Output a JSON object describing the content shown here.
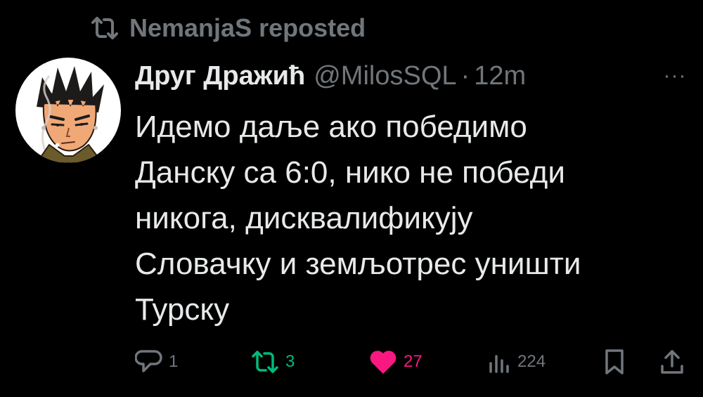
{
  "repost": {
    "icon": "repost-icon",
    "text": "NemanjaS reposted"
  },
  "tweet": {
    "author": {
      "display_name": "Друг Дражић",
      "handle": "@MilosSQL",
      "separator": "·",
      "time": "12m",
      "avatar_icon": "anime-character-avatar"
    },
    "more_icon": "more-icon",
    "more_label": "···",
    "body_lines": [
      "Идемо даље ако победимо",
      "Данску са 6:0, нико не победи",
      "никога, дисквалификују",
      "Словачку и земљотрес уништи",
      "Турску"
    ],
    "actions": {
      "reply": {
        "icon": "reply-icon",
        "count": "1"
      },
      "repost": {
        "icon": "repost-icon",
        "count": "3"
      },
      "like": {
        "icon": "heart-icon",
        "count": "27"
      },
      "views": {
        "icon": "views-icon",
        "count": "224"
      },
      "bookmark": {
        "icon": "bookmark-icon"
      },
      "share": {
        "icon": "share-icon"
      }
    }
  },
  "colors": {
    "background": "#000000",
    "text_primary": "#e7e9ea",
    "text_secondary": "#71767b",
    "repost_green": "#00ba7c",
    "like_pink": "#f91880"
  }
}
